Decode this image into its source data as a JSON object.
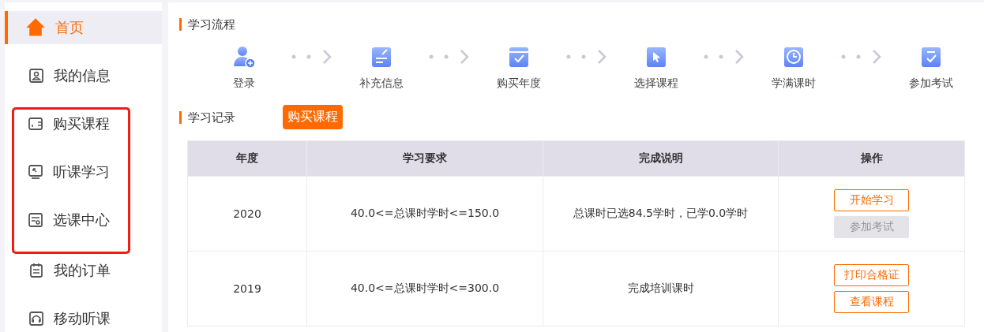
{
  "sidebar": {
    "items": [
      {
        "label": "首页",
        "kind": "home",
        "selected": true,
        "highlighted": false
      },
      {
        "label": "我的信息",
        "kind": "profile",
        "selected": false,
        "highlighted": false
      },
      {
        "label": "购买课程",
        "kind": "wallet",
        "selected": false,
        "highlighted": true
      },
      {
        "label": "听课学习",
        "kind": "monitor",
        "selected": false,
        "highlighted": true
      },
      {
        "label": "选课中心",
        "kind": "choose",
        "selected": false,
        "highlighted": true
      },
      {
        "label": "我的订单",
        "kind": "order",
        "selected": false,
        "highlighted": false
      },
      {
        "label": "移动听课",
        "kind": "headphones",
        "selected": false,
        "highlighted": false
      }
    ]
  },
  "process": {
    "title": "学习流程",
    "steps": [
      {
        "label": "登录",
        "kind": "user-add"
      },
      {
        "label": "补充信息",
        "kind": "form"
      },
      {
        "label": "购买年度",
        "kind": "calendar"
      },
      {
        "label": "选择课程",
        "kind": "cursor"
      },
      {
        "label": "学满课时",
        "kind": "clock"
      },
      {
        "label": "参加考试",
        "kind": "exam"
      }
    ]
  },
  "records": {
    "title": "学习记录",
    "buy_button": "购买课程",
    "table": {
      "columns": [
        "年度",
        "学习要求",
        "完成说明",
        "操作"
      ],
      "rows": [
        {
          "year": "2020",
          "requirement": "40.0<=总课时学时<=150.0",
          "note": "总课时已选84.5学时，已学0.0学时",
          "actions": [
            {
              "label": "开始学习",
              "disabled": false
            },
            {
              "label": "参加考试",
              "disabled": true
            }
          ]
        },
        {
          "year": "2019",
          "requirement": "40.0<=总课时学时<=300.0",
          "note": "完成培训课时",
          "actions": [
            {
              "label": "打印合格证",
              "disabled": false
            },
            {
              "label": "查看课程",
              "disabled": false
            }
          ]
        }
      ]
    }
  }
}
